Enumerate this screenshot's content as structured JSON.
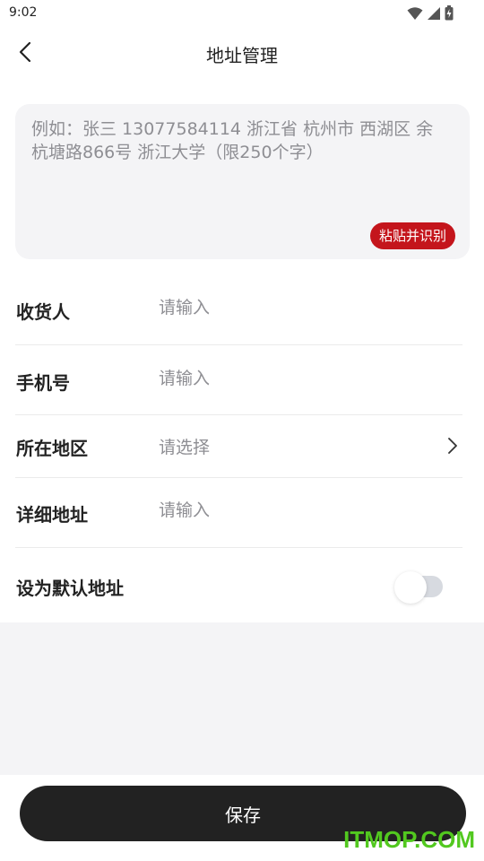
{
  "status_bar": {
    "time": "9:02"
  },
  "header": {
    "title": "地址管理"
  },
  "paste": {
    "placeholder": "例如：张三 13077584114 浙江省 杭州市 西湖区 余杭塘路866号 浙江大学（限250个字）",
    "button_label": "粘贴并识别"
  },
  "form": {
    "recipient": {
      "label": "收货人",
      "placeholder": "请输入"
    },
    "phone": {
      "label": "手机号",
      "placeholder": "请输入"
    },
    "region": {
      "label": "所在地区",
      "placeholder": "请选择"
    },
    "detail": {
      "label": "详细地址",
      "placeholder": "请输入"
    },
    "default": {
      "label": "设为默认地址",
      "enabled": false
    }
  },
  "footer": {
    "save_label": "保存"
  },
  "watermark": {
    "text": "ITMOP.COM"
  },
  "colors": {
    "accent": "#c4151c",
    "primary_button": "#222222",
    "watermark": "#52c81f"
  }
}
